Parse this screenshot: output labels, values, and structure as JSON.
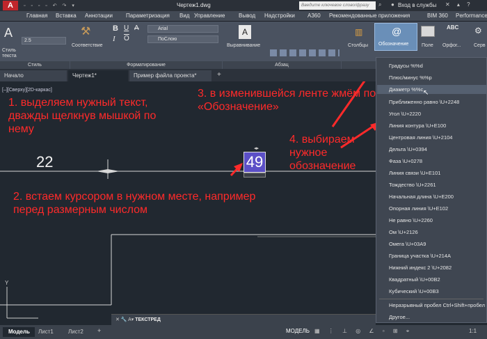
{
  "titlebar": {
    "filename": "Чертеж1.dwg",
    "search_placeholder": "Введите ключевое слово/фразу",
    "login": "Вход в службы"
  },
  "menu": [
    "Главная",
    "Вставка",
    "Аннотации",
    "Параметризация",
    "Вид",
    "Управление",
    "Вывод",
    "Надстройки",
    "A360",
    "Рекомендованные приложения",
    "BIM 360",
    "Performance"
  ],
  "ribbon": {
    "style_label": "Стиль текста",
    "style_value": "2.5",
    "compliance": "Соответствие",
    "font": "Arial",
    "layer": "ПоСлою",
    "align": "Выравнивание",
    "columns": "Столбцы",
    "symbol": "Обозначение",
    "field": "Поле",
    "spell": "Орфог...",
    "spell_icon": "ABC",
    "service": "Серв",
    "groups": {
      "style": "Стиль",
      "format": "Форматирование",
      "paragraph": "Абзац"
    }
  },
  "tabs": [
    "Начало",
    "Чертеж1*",
    "Пример файла проекта*"
  ],
  "viewport_label": "[–][Сверху][2D-каркас]",
  "dimension_value": "22",
  "edit_value": "49",
  "annotations": {
    "step1": "1. выделяем нужный текст, дважды щелкнув мышкой по нему",
    "step2": "2. встаем курсором в нужном месте,  например перед размерным числом",
    "step3": "3. в изменившейся ленте жмём по «Обозначение»",
    "step4": "4. выбираем нужное обозначение"
  },
  "dropdown": [
    "Градусы  %%d",
    "Плюс/минус  %%p",
    "Диаметр  %%c",
    "Приближенно равно  \\U+2248",
    "Угол  \\U+2220",
    "Линия контура  \\U+E100",
    "Центровая линия  \\U+2104",
    "Дельта  \\U+0394",
    "Фаза  \\U+0278",
    "Линия связи  \\U+E101",
    "Тождество  \\U+2261",
    "Начальная длина  \\U+E200",
    "Опорная линия  \\U+E102",
    "Не равно  \\U+2260",
    "Ом  \\U+2126",
    "Омега  \\U+03A9",
    "Граница участка  \\U+214A",
    "Нижний индекс 2  \\U+2082",
    "Квадратный  \\U+00B2",
    "Кубический  \\U+00B3",
    "Неразрывный пробел Ctrl+Shift+пробел",
    "Другое..."
  ],
  "command": "ТЕКСТРЕД",
  "status": {
    "model_tab": "Модель",
    "sheet1": "Лист1",
    "sheet2": "Лист2",
    "model_btn": "МОДЕЛЬ",
    "scale": "1:1"
  },
  "colors": {
    "accent_red": "#ff2a2a",
    "edit_box": "#5b4fc7"
  }
}
